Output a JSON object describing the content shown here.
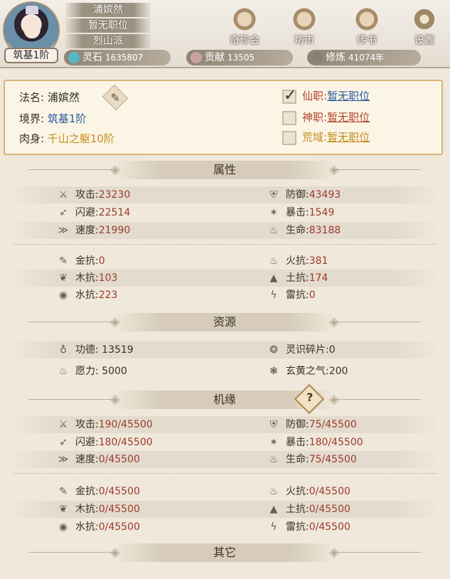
{
  "header": {
    "realm_badge": "筑基1阶",
    "plates": [
      "浦嫔然",
      "暂无职位",
      "烈山派"
    ],
    "buttons": [
      {
        "label": "奇珍会",
        "icon": "treasure-pavilion-icon"
      },
      {
        "label": "坊市",
        "icon": "market-icon"
      },
      {
        "label": "传书",
        "icon": "scroll-icon"
      },
      {
        "label": "设置",
        "icon": "gear-icon"
      }
    ],
    "resources": [
      {
        "label": "灵石",
        "value": "1635807",
        "icon": "spirit-stone-icon",
        "color": "#58b7c7"
      },
      {
        "label": "贡献",
        "value": "13505",
        "icon": "contribution-icon",
        "color": "#c9a3a0"
      },
      {
        "label": "修炼",
        "value": "41074年",
        "icon": "cultivation-icon",
        "color": "#8a7f70"
      }
    ]
  },
  "profile": {
    "name_key": "法名:",
    "name_value": "浦嫔然",
    "realm_key": "境界:",
    "realm_value": "筑基1阶",
    "body_key": "肉身:",
    "body_value": "千山之躯10阶",
    "jobs": [
      {
        "key": "仙职:",
        "value": "暂无职位",
        "checked": true
      },
      {
        "key": "神职:",
        "value": "暂无职位",
        "checked": false
      },
      {
        "key": "荒域:",
        "value": "暂无职位",
        "checked": false
      }
    ]
  },
  "sections": {
    "attributes": "属性",
    "resources": "资源",
    "fortune": "机缘",
    "others": "其它"
  },
  "attributes": {
    "combat": [
      {
        "k": "攻击:",
        "v": "23230",
        "icon": "sword-icon"
      },
      {
        "k": "防御:",
        "v": "43493",
        "icon": "shield-icon"
      },
      {
        "k": "闪避:",
        "v": "22514",
        "icon": "dodge-icon"
      },
      {
        "k": "暴击:",
        "v": "1549",
        "icon": "crit-icon"
      },
      {
        "k": "速度:",
        "v": "21990",
        "icon": "speed-icon"
      },
      {
        "k": "生命:",
        "v": "83188",
        "icon": "life-icon"
      }
    ],
    "resist": [
      {
        "k": "金抗:",
        "v": "0",
        "icon": "metal-icon"
      },
      {
        "k": "火抗:",
        "v": "381",
        "icon": "fire-icon"
      },
      {
        "k": "木抗:",
        "v": "103",
        "icon": "wood-icon"
      },
      {
        "k": "土抗:",
        "v": "174",
        "icon": "earth-icon"
      },
      {
        "k": "水抗:",
        "v": "223",
        "icon": "water-icon"
      },
      {
        "k": "雷抗:",
        "v": "0",
        "icon": "thunder-icon"
      }
    ]
  },
  "resources": [
    {
      "k": "功德:",
      "v": "13519",
      "icon": "merit-icon"
    },
    {
      "k": "灵识碎片:",
      "v": "0",
      "icon": "soul-shard-icon"
    },
    {
      "k": "愿力:",
      "v": "5000",
      "icon": "wish-icon"
    },
    {
      "k": "玄黄之气:",
      "v": "200",
      "icon": "xuanhuang-qi-icon"
    }
  ],
  "fortune": {
    "help": "?",
    "combat": [
      {
        "k": "攻击:",
        "v": "190/45500",
        "icon": "sword-icon"
      },
      {
        "k": "防御:",
        "v": "75/45500",
        "icon": "shield-icon"
      },
      {
        "k": "闪避:",
        "v": "180/45500",
        "icon": "dodge-icon"
      },
      {
        "k": "暴击:",
        "v": "180/45500",
        "icon": "crit-icon"
      },
      {
        "k": "速度:",
        "v": "0/45500",
        "icon": "speed-icon"
      },
      {
        "k": "生命:",
        "v": "75/45500",
        "icon": "life-icon"
      }
    ],
    "resist": [
      {
        "k": "金抗:",
        "v": "0/45500",
        "icon": "metal-icon"
      },
      {
        "k": "火抗:",
        "v": "0/45500",
        "icon": "fire-icon"
      },
      {
        "k": "木抗:",
        "v": "0/45500",
        "icon": "wood-icon"
      },
      {
        "k": "土抗:",
        "v": "0/45500",
        "icon": "earth-icon"
      },
      {
        "k": "水抗:",
        "v": "0/45500",
        "icon": "water-icon"
      },
      {
        "k": "雷抗:",
        "v": "0/45500",
        "icon": "thunder-icon"
      }
    ]
  }
}
